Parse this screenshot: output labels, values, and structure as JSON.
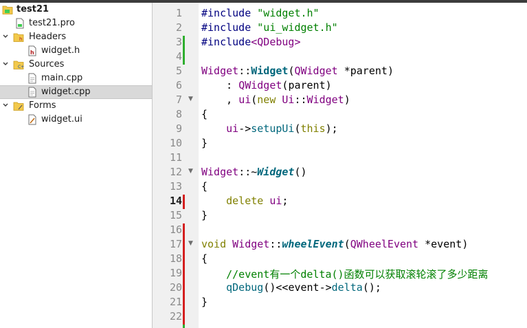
{
  "project_tree": {
    "project": "test21",
    "pro_file": "test21.pro",
    "headers_label": "Headers",
    "header_file": "widget.h",
    "sources_label": "Sources",
    "source_files": [
      "main.cpp",
      "widget.cpp"
    ],
    "forms_label": "Forms",
    "form_file": "widget.ui",
    "selected": "widget.cpp"
  },
  "editor": {
    "current_line": 14,
    "line_numbers": [
      "1",
      "2",
      "3",
      "4",
      "5",
      "6",
      "7",
      "8",
      "9",
      "10",
      "11",
      "12",
      "13",
      "14",
      "15",
      "16",
      "17",
      "18",
      "19",
      "20",
      "21",
      "22"
    ],
    "lines": {
      "l1a": "#include ",
      "l1b": "\"widget.h\"",
      "l2a": "#include ",
      "l2b": "\"ui_widget.h\"",
      "l3a": "#include",
      "l3b": "<QDebug>",
      "l5a": "Widget",
      "l5b": "::",
      "l5c": "Widget",
      "l5d": "(",
      "l5e": "QWidget",
      "l5f": " *",
      "l5g": "parent",
      "l5h": ")",
      "l6a": "    : ",
      "l6b": "QWidget",
      "l6c": "(",
      "l6d": "parent",
      "l6e": ")",
      "l7a": "    , ",
      "l7b": "ui",
      "l7c": "(",
      "l7d": "new",
      "l7e": " ",
      "l7f": "Ui",
      "l7g": "::",
      "l7h": "Widget",
      "l7i": ")",
      "l8": "{",
      "l9a": "    ",
      "l9b": "ui",
      "l9c": "->",
      "l9d": "setupUi",
      "l9e": "(",
      "l9f": "this",
      "l9g": ");",
      "l10": "}",
      "l12a": "Widget",
      "l12b": "::~",
      "l12c": "Widget",
      "l12d": "()",
      "l13": "{",
      "l14a": "    ",
      "l14b": "delete",
      "l14c": " ",
      "l14d": "ui",
      "l14e": ";",
      "l15": "}",
      "l17a": "void",
      "l17b": " ",
      "l17c": "Widget",
      "l17d": "::",
      "l17e": "wheelEvent",
      "l17f": "(",
      "l17g": "QWheelEvent",
      "l17h": " *",
      "l17i": "event",
      "l17j": ")",
      "l18": "{",
      "l19a": "    ",
      "l19b": "//event有一个delta()函数可以获取滚轮滚了多少距离",
      "l20a": "    ",
      "l20b": "qDebug",
      "l20c": "()<<",
      "l20d": "event",
      "l20e": "->",
      "l20f": "delta",
      "l20g": "();",
      "l21": "}"
    }
  },
  "colors": {
    "preprocessor": "#000080",
    "string": "#008000",
    "type": "#800080",
    "keyword": "#808000",
    "function": "#00677c",
    "comment": "#008000",
    "change_added": "#2eae2e",
    "change_modified": "#d41e1e"
  }
}
